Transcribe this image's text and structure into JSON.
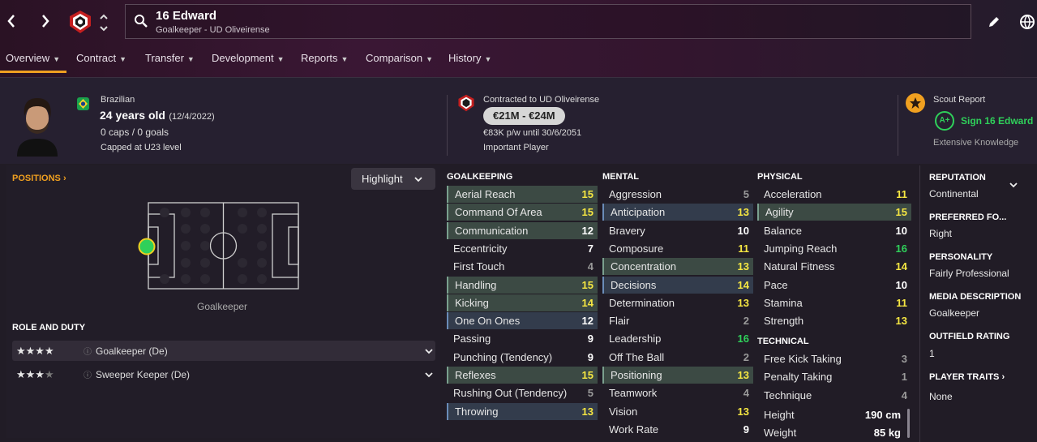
{
  "header": {
    "player_name": "16 Edward",
    "player_sub": "Goalkeeper - UD Oliveirense",
    "back_icon": "chevron-left-icon",
    "forward_icon": "chevron-right-icon",
    "edit_icon": "pencil-icon",
    "globe_icon": "globe-icon"
  },
  "tabs": [
    {
      "label": "Overview",
      "active": true
    },
    {
      "label": "Contract"
    },
    {
      "label": "Transfer"
    },
    {
      "label": "Development"
    },
    {
      "label": "Reports"
    },
    {
      "label": "Comparison"
    },
    {
      "label": "History"
    }
  ],
  "bio": {
    "nationality": "Brazilian",
    "age": "24 years old",
    "dob": "(12/4/2022)",
    "caps": "0 caps / 0 goals",
    "capped_level": "Capped at U23 level"
  },
  "contract": {
    "club": "Contracted to UD Oliveirense",
    "value": "€21M - €24M",
    "wage": "€83K p/w until 30/6/2051",
    "status": "Important Player"
  },
  "scout": {
    "title": "Scout Report",
    "grade": "A+",
    "recommendation": "Sign 16 Edward",
    "knowledge": "Extensive Knowledge"
  },
  "positions": {
    "title": "POSITIONS",
    "highlight_label": "Highlight",
    "position_label": "Goalkeeper"
  },
  "roles": {
    "title": "ROLE AND DUTY",
    "items": [
      {
        "stars": "★★★★",
        "rating": 4,
        "label": "Goalkeeper (De)"
      },
      {
        "stars": "★★★",
        "rating": 3.5,
        "label": "Sweeper Keeper (De)"
      }
    ]
  },
  "attributes": {
    "goalkeeping": {
      "title": "GOALKEEPING",
      "items": [
        {
          "name": "Aerial Reach",
          "value": "15",
          "hl": "g",
          "color": "#f5e642"
        },
        {
          "name": "Command Of Area",
          "value": "15",
          "hl": "g",
          "color": "#f5e642"
        },
        {
          "name": "Communication",
          "value": "12",
          "hl": "g",
          "color": "#ffffff"
        },
        {
          "name": "Eccentricity",
          "value": "7",
          "hl": "",
          "color": "#ffffff"
        },
        {
          "name": "First Touch",
          "value": "4",
          "hl": "",
          "color": "#9a9a9a"
        },
        {
          "name": "Handling",
          "value": "15",
          "hl": "g",
          "color": "#f5e642"
        },
        {
          "name": "Kicking",
          "value": "14",
          "hl": "g",
          "color": "#f5e642"
        },
        {
          "name": "One On Ones",
          "value": "12",
          "hl": "b",
          "color": "#ffffff"
        },
        {
          "name": "Passing",
          "value": "9",
          "hl": "",
          "color": "#ffffff"
        },
        {
          "name": "Punching (Tendency)",
          "value": "9",
          "hl": "",
          "color": "#ffffff"
        },
        {
          "name": "Reflexes",
          "value": "15",
          "hl": "g",
          "color": "#f5e642"
        },
        {
          "name": "Rushing Out (Tendency)",
          "value": "5",
          "hl": "",
          "color": "#9a9a9a"
        },
        {
          "name": "Throwing",
          "value": "13",
          "hl": "b",
          "color": "#f5e642"
        }
      ]
    },
    "mental": {
      "title": "MENTAL",
      "items": [
        {
          "name": "Aggression",
          "value": "5",
          "hl": "",
          "color": "#9a9a9a"
        },
        {
          "name": "Anticipation",
          "value": "13",
          "hl": "b",
          "color": "#f5e642"
        },
        {
          "name": "Bravery",
          "value": "10",
          "hl": "",
          "color": "#ffffff"
        },
        {
          "name": "Composure",
          "value": "11",
          "hl": "",
          "color": "#f5e642"
        },
        {
          "name": "Concentration",
          "value": "13",
          "hl": "g",
          "color": "#f5e642"
        },
        {
          "name": "Decisions",
          "value": "14",
          "hl": "b",
          "color": "#f5e642"
        },
        {
          "name": "Determination",
          "value": "13",
          "hl": "",
          "color": "#f5e642"
        },
        {
          "name": "Flair",
          "value": "2",
          "hl": "",
          "color": "#9a9a9a"
        },
        {
          "name": "Leadership",
          "value": "16",
          "hl": "",
          "color": "#2fd05a"
        },
        {
          "name": "Off The Ball",
          "value": "2",
          "hl": "",
          "color": "#9a9a9a"
        },
        {
          "name": "Positioning",
          "value": "13",
          "hl": "g",
          "color": "#f5e642"
        },
        {
          "name": "Teamwork",
          "value": "4",
          "hl": "",
          "color": "#9a9a9a"
        },
        {
          "name": "Vision",
          "value": "13",
          "hl": "",
          "color": "#f5e642"
        },
        {
          "name": "Work Rate",
          "value": "9",
          "hl": "",
          "color": "#ffffff"
        }
      ]
    },
    "physical": {
      "title": "PHYSICAL",
      "items": [
        {
          "name": "Acceleration",
          "value": "11",
          "hl": "",
          "color": "#f5e642"
        },
        {
          "name": "Agility",
          "value": "15",
          "hl": "g",
          "color": "#f5e642"
        },
        {
          "name": "Balance",
          "value": "10",
          "hl": "",
          "color": "#ffffff"
        },
        {
          "name": "Jumping Reach",
          "value": "16",
          "hl": "",
          "color": "#2fd05a"
        },
        {
          "name": "Natural Fitness",
          "value": "14",
          "hl": "",
          "color": "#f5e642"
        },
        {
          "name": "Pace",
          "value": "10",
          "hl": "",
          "color": "#ffffff"
        },
        {
          "name": "Stamina",
          "value": "11",
          "hl": "",
          "color": "#f5e642"
        },
        {
          "name": "Strength",
          "value": "13",
          "hl": "",
          "color": "#f5e642"
        }
      ]
    },
    "technical": {
      "title": "TECHNICAL",
      "items": [
        {
          "name": "Free Kick Taking",
          "value": "3",
          "hl": "",
          "color": "#9a9a9a"
        },
        {
          "name": "Penalty Taking",
          "value": "1",
          "hl": "",
          "color": "#9a9a9a"
        },
        {
          "name": "Technique",
          "value": "4",
          "hl": "",
          "color": "#9a9a9a"
        }
      ]
    },
    "body": {
      "items": [
        {
          "name": "Height",
          "value": "190 cm"
        },
        {
          "name": "Weight",
          "value": "85 kg"
        }
      ]
    }
  },
  "right_panel": {
    "reputation_title": "REPUTATION",
    "reputation": "Continental",
    "foot_title": "PREFERRED FO...",
    "foot": "Right",
    "personality_title": "PERSONALITY",
    "personality": "Fairly Professional",
    "media_title": "MEDIA DESCRIPTION",
    "media": "Goalkeeper",
    "outfield_title": "OUTFIELD RATING",
    "outfield": "1",
    "traits_title": "PLAYER TRAITS",
    "traits": "None"
  }
}
